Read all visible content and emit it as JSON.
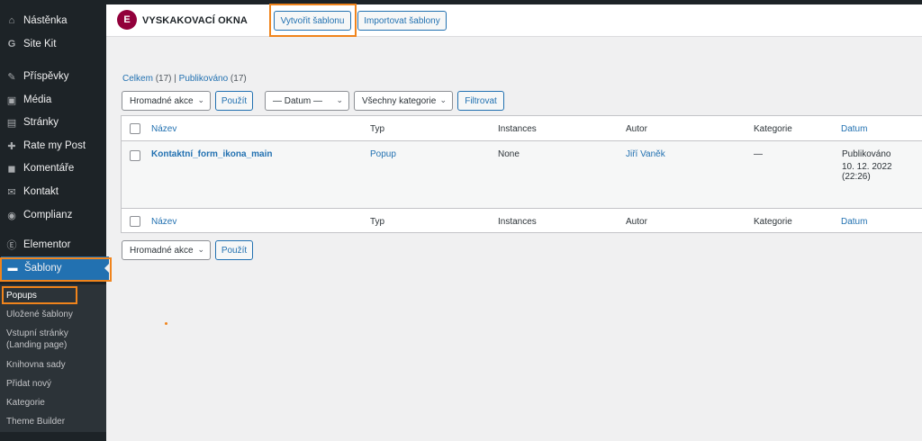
{
  "colors": {
    "accent": "#2271b1",
    "highlight": "#f0841c",
    "sidebar": "#1d2327",
    "elementor": "#92003b"
  },
  "sidebar": {
    "items": [
      {
        "label": "Nástěnka",
        "icon": "dashboard-icon",
        "glyph": "⌂"
      },
      {
        "label": "Site Kit",
        "icon": "google-icon",
        "glyph": "G"
      },
      {
        "label": "Příspěvky",
        "icon": "pin-icon",
        "glyph": "✎"
      },
      {
        "label": "Média",
        "icon": "media-icon",
        "glyph": "▣"
      },
      {
        "label": "Stránky",
        "icon": "pages-icon",
        "glyph": "▤"
      },
      {
        "label": "Rate my Post",
        "icon": "thumbs-up-icon",
        "glyph": "✚"
      },
      {
        "label": "Komentáře",
        "icon": "comment-icon",
        "glyph": "◼"
      },
      {
        "label": "Kontakt",
        "icon": "mail-icon",
        "glyph": "✉"
      },
      {
        "label": "Complianz",
        "icon": "complianz-icon",
        "glyph": "◉"
      },
      {
        "label": "Elementor",
        "icon": "elementor-icon",
        "glyph": "Ⓔ"
      },
      {
        "label": "Šablony",
        "icon": "folder-icon",
        "glyph": "▬"
      }
    ],
    "submenu": [
      "Popups",
      "Uložené šablony",
      "Vstupní stránky",
      "(Landing page)",
      "Knihovna sady",
      "Přidat nový",
      "Kategorie",
      "Theme Builder"
    ]
  },
  "header": {
    "logo": "E",
    "title": "VYSKAKOVACÍ OKNA",
    "create_button": "Vytvořit šablonu",
    "import_button": "Importovat šablony"
  },
  "views": {
    "all_label": "Celkem",
    "all_count": "(17)",
    "separator": "|",
    "published_label": "Publikováno",
    "published_count": "(17)"
  },
  "filters": {
    "bulk_action": "Hromadné akce",
    "apply": "Použít",
    "date": "— Datum —",
    "categories": "Všechny kategorie",
    "filter": "Filtrovat"
  },
  "table": {
    "columns": [
      "Název",
      "Typ",
      "Instances",
      "Autor",
      "Kategorie",
      "Datum"
    ],
    "rows": [
      {
        "name": "Kontaktní_form_ikona_main",
        "type": "Popup",
        "instances": "None",
        "author": "Jiří Vaněk",
        "category": "—",
        "status": "Publikováno",
        "date": "10. 12. 2022 (22:26)"
      }
    ]
  },
  "chevron": "⌄"
}
